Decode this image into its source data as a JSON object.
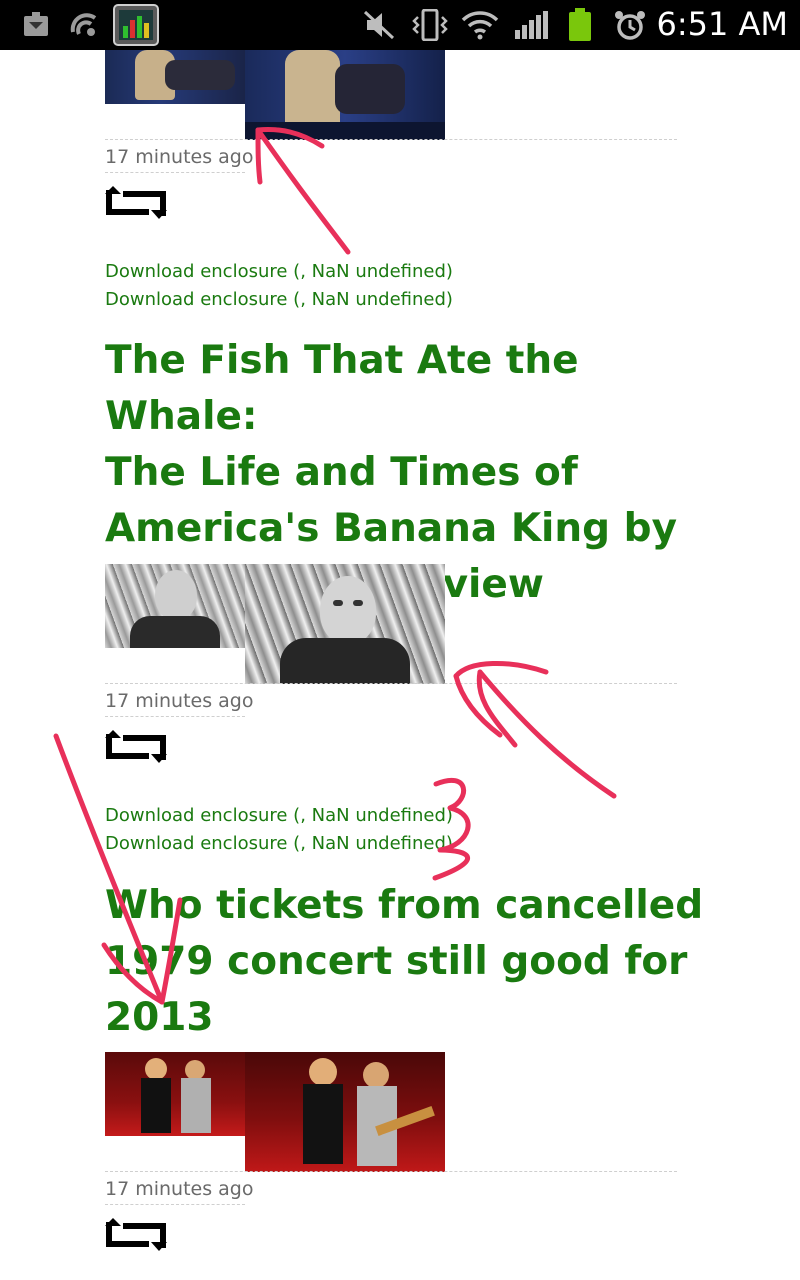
{
  "status_bar": {
    "time": "6:51 AM",
    "icons": [
      "download-icon",
      "sync-icon",
      "taskmanager-app-icon",
      "mute-icon",
      "vibrate-icon",
      "wifi-icon",
      "signal-icon",
      "battery-icon",
      "alarm-icon"
    ],
    "colors": {
      "background": "#000000",
      "battery": "#7ac70c"
    }
  },
  "feed": {
    "items": [
      {
        "time_ago": "17 minutes ago",
        "enclosures": [
          "Download enclosure (, NaN undefined)",
          "Download enclosure (, NaN undefined)"
        ]
      },
      {
        "title": "The Fish That Ate the Whale: The Life and Times of America's Banana King by Rich Cohen – review",
        "title_lines": [
          "The Fish That Ate the Whale:",
          "The Life and Times of",
          "America's Banana King by",
          "Rich Cohen – review"
        ],
        "time_ago": "17 minutes ago",
        "enclosures": [
          "Download enclosure (, NaN undefined)",
          "Download enclosure (, NaN undefined)"
        ]
      },
      {
        "title": "Who tickets from cancelled 1979 concert still good for 2013",
        "title_lines": [
          "Who tickets from cancelled",
          "1979 concert still good for",
          "2013"
        ],
        "time_ago": "17 minutes ago"
      }
    ]
  },
  "colors": {
    "link": "#1a7a10",
    "meta": "#6a6a6a",
    "annotation": "#e8305a"
  }
}
